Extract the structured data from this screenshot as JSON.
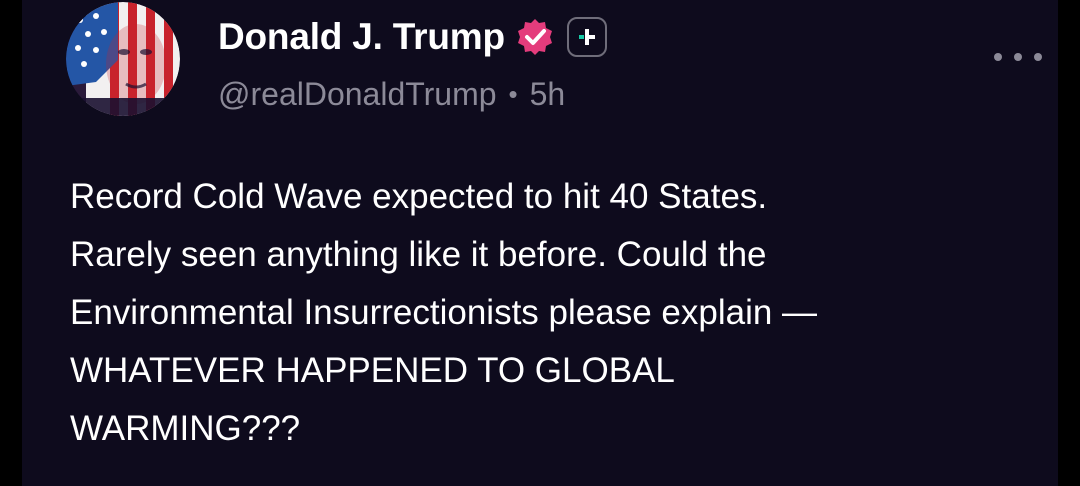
{
  "post": {
    "author": {
      "display_name": "Donald J. Trump",
      "handle": "@realDonaldTrump",
      "verified_icon": "verified-badge-icon",
      "avatar": "flag-portrait-avatar"
    },
    "separator": "•",
    "timestamp": "5h",
    "follow_icon": "plus-icon",
    "more_icon": "more-horizontal-icon",
    "body_lines": [
      "Record Cold Wave expected to hit 40 States.",
      "Rarely seen anything like it before. Could the",
      "Environmental Insurrectionists please explain —",
      "WHATEVER HAPPENED TO GLOBAL",
      "WARMING???"
    ]
  },
  "colors": {
    "background": "#0e0b1d",
    "verified_badge": "#e43c7c",
    "follow_accent": "#17c9a5",
    "text_primary": "#ffffff",
    "text_secondary": "#8c8a98"
  }
}
